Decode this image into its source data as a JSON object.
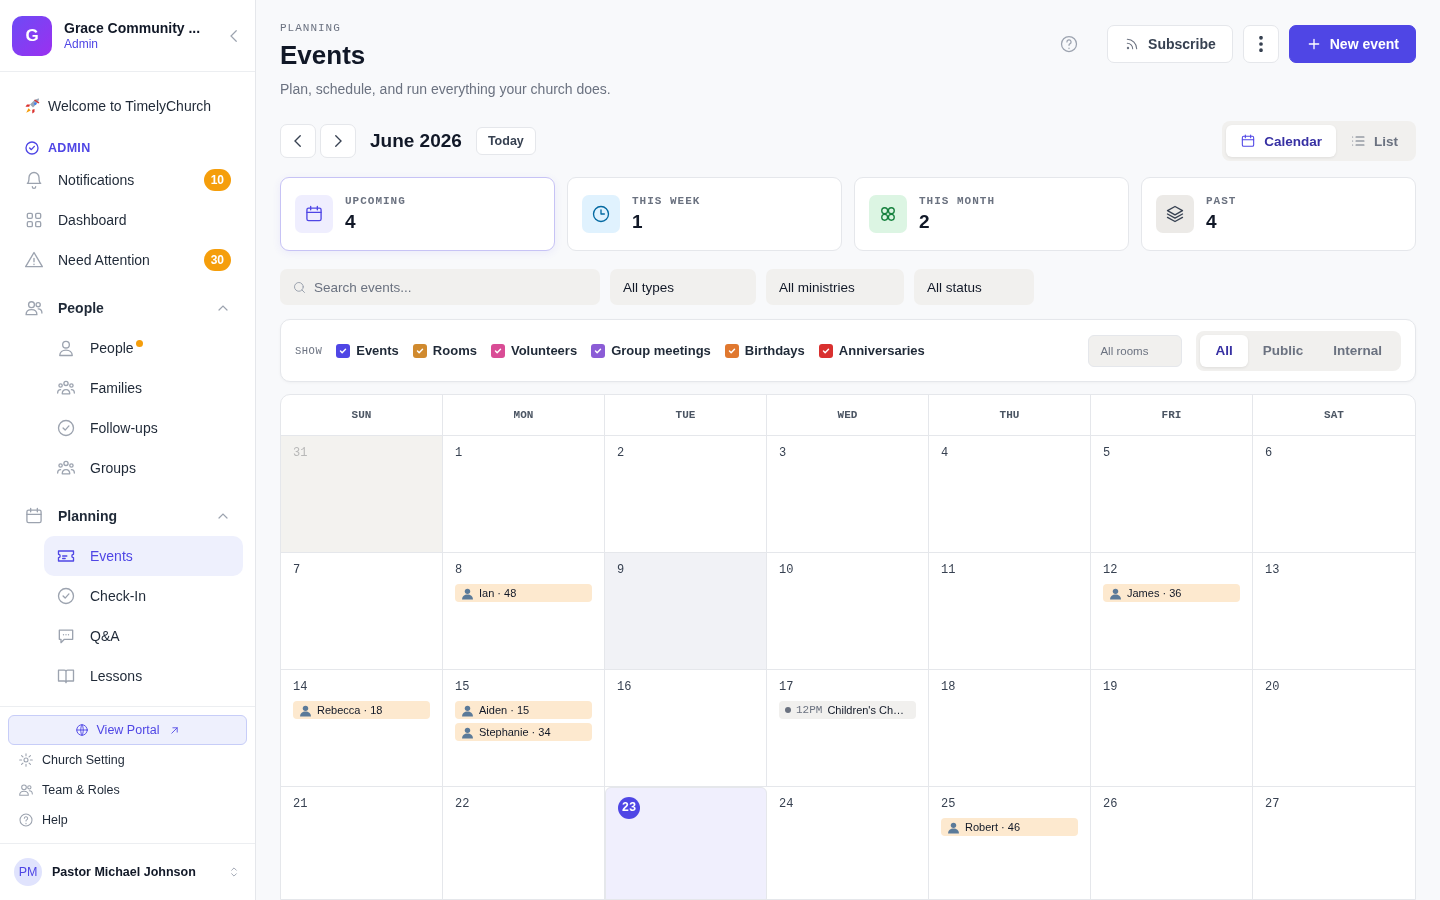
{
  "sidebar": {
    "org_initial": "G",
    "org_name": "Grace Community ...",
    "org_role": "Admin",
    "welcome": "Welcome to TimelyChurch",
    "section": "ADMIN",
    "items": [
      {
        "label": "Notifications",
        "badge": "10",
        "selected": false
      },
      {
        "label": "Dashboard",
        "selected": false
      },
      {
        "label": "Need Attention",
        "badge": "30",
        "selected": false
      },
      {
        "label": "People",
        "expanded": true,
        "selected": false,
        "children": [
          {
            "label": "People",
            "dot": true,
            "selected": false
          },
          {
            "label": "Families",
            "dot": false,
            "selected": false
          },
          {
            "label": "Follow-ups",
            "dot": false,
            "selected": false
          },
          {
            "label": "Groups",
            "dot": false,
            "selected": false
          }
        ]
      },
      {
        "label": "Planning",
        "expanded": true,
        "selected": false,
        "children": [
          {
            "label": "Events",
            "dot": false,
            "selected": true
          },
          {
            "label": "Check-In",
            "dot": false,
            "selected": false
          },
          {
            "label": "Q&A",
            "dot": false,
            "selected": false
          },
          {
            "label": "Lessons",
            "dot": false,
            "selected": false
          }
        ]
      }
    ],
    "portal": "View Portal",
    "links": [
      "Church Setting",
      "Team & Roles",
      "Help"
    ],
    "user": {
      "initials": "PM",
      "name": "Pastor Michael Johnson"
    }
  },
  "header": {
    "eyebrow": "PLANNING",
    "title": "Events",
    "subtitle": "Plan, schedule, and run everything your church does.",
    "subscribe": "Subscribe",
    "new_event": "New event"
  },
  "toolbar": {
    "month": "June 2026",
    "today": "Today",
    "views": [
      {
        "label": "Calendar",
        "selected": true
      },
      {
        "label": "List",
        "selected": false
      }
    ]
  },
  "stats": [
    {
      "label": "UPCOMING",
      "value": "4",
      "selected": true
    },
    {
      "label": "THIS WEEK",
      "value": "1",
      "selected": false
    },
    {
      "label": "THIS MONTH",
      "value": "2",
      "selected": false
    },
    {
      "label": "PAST",
      "value": "4",
      "selected": false
    }
  ],
  "filters": {
    "search_placeholder": "Search events...",
    "selects": [
      "All types",
      "All ministries",
      "All status"
    ]
  },
  "legend": {
    "label": "SHOW",
    "items": [
      {
        "label": "Events",
        "checked": true,
        "color": "#4f46e5"
      },
      {
        "label": "Rooms",
        "checked": true,
        "color": "#d08a2e"
      },
      {
        "label": "Volunteers",
        "checked": true,
        "color": "#d94c95"
      },
      {
        "label": "Group meetings",
        "checked": true,
        "color": "#8b5cd6"
      },
      {
        "label": "Birthdays",
        "checked": true,
        "color": "#e0782f"
      },
      {
        "label": "Anniversaries",
        "checked": true,
        "color": "#d9302f"
      }
    ],
    "rooms": "All rooms",
    "visibility": [
      {
        "label": "All",
        "selected": true
      },
      {
        "label": "Public",
        "selected": false
      },
      {
        "label": "Internal",
        "selected": false
      }
    ]
  },
  "calendar": {
    "weekdays": [
      "SUN",
      "MON",
      "TUE",
      "WED",
      "THU",
      "FRI",
      "SAT"
    ],
    "weeks": [
      [
        {
          "day": "31",
          "outside": true,
          "today": false,
          "hover": false
        },
        {
          "day": "1",
          "outside": false,
          "today": false,
          "hover": false
        },
        {
          "day": "2",
          "outside": false,
          "today": false,
          "hover": false
        },
        {
          "day": "3",
          "outside": false,
          "today": false,
          "hover": false
        },
        {
          "day": "4",
          "outside": false,
          "today": false,
          "hover": false
        },
        {
          "day": "5",
          "outside": false,
          "today": false,
          "hover": false
        },
        {
          "day": "6",
          "outside": false,
          "today": false,
          "hover": false
        }
      ],
      [
        {
          "day": "7",
          "outside": false,
          "today": false,
          "hover": false
        },
        {
          "day": "8",
          "outside": false,
          "today": false,
          "hover": false,
          "events": [
            {
              "kind": "birthday",
              "label": "Ian · 48"
            }
          ]
        },
        {
          "day": "9",
          "outside": false,
          "today": false,
          "hover": true
        },
        {
          "day": "10",
          "outside": false,
          "today": false,
          "hover": false
        },
        {
          "day": "11",
          "outside": false,
          "today": false,
          "hover": false
        },
        {
          "day": "12",
          "outside": false,
          "today": false,
          "hover": false,
          "events": [
            {
              "kind": "birthday",
              "label": "James · 36"
            }
          ]
        },
        {
          "day": "13",
          "outside": false,
          "today": false,
          "hover": false
        }
      ],
      [
        {
          "day": "14",
          "outside": false,
          "today": false,
          "hover": false,
          "events": [
            {
              "kind": "birthday",
              "label": "Rebecca · 18"
            }
          ]
        },
        {
          "day": "15",
          "outside": false,
          "today": false,
          "hover": false,
          "events": [
            {
              "kind": "birthday",
              "label": "Aiden · 15"
            },
            {
              "kind": "birthday",
              "label": "Stephanie · 34"
            }
          ]
        },
        {
          "day": "16",
          "outside": false,
          "today": false,
          "hover": false
        },
        {
          "day": "17",
          "outside": false,
          "today": false,
          "hover": false,
          "events": [
            {
              "kind": "event",
              "time": "12PM",
              "title": "Children's Ch…",
              "color": "#6b7280"
            }
          ]
        },
        {
          "day": "18",
          "outside": false,
          "today": false,
          "hover": false
        },
        {
          "day": "19",
          "outside": false,
          "today": false,
          "hover": false
        },
        {
          "day": "20",
          "outside": false,
          "today": false,
          "hover": false
        }
      ],
      [
        {
          "day": "21",
          "outside": false,
          "today": false,
          "hover": false
        },
        {
          "day": "22",
          "outside": false,
          "today": false,
          "hover": false
        },
        {
          "day": "23",
          "outside": false,
          "today": true,
          "hover": false
        },
        {
          "day": "24",
          "outside": false,
          "today": false,
          "hover": false
        },
        {
          "day": "25",
          "outside": false,
          "today": false,
          "hover": false,
          "events": [
            {
              "kind": "birthday",
              "label": "Robert · 46"
            }
          ]
        },
        {
          "day": "26",
          "outside": false,
          "today": false,
          "hover": false
        },
        {
          "day": "27",
          "outside": false,
          "today": false,
          "hover": false
        }
      ]
    ]
  }
}
